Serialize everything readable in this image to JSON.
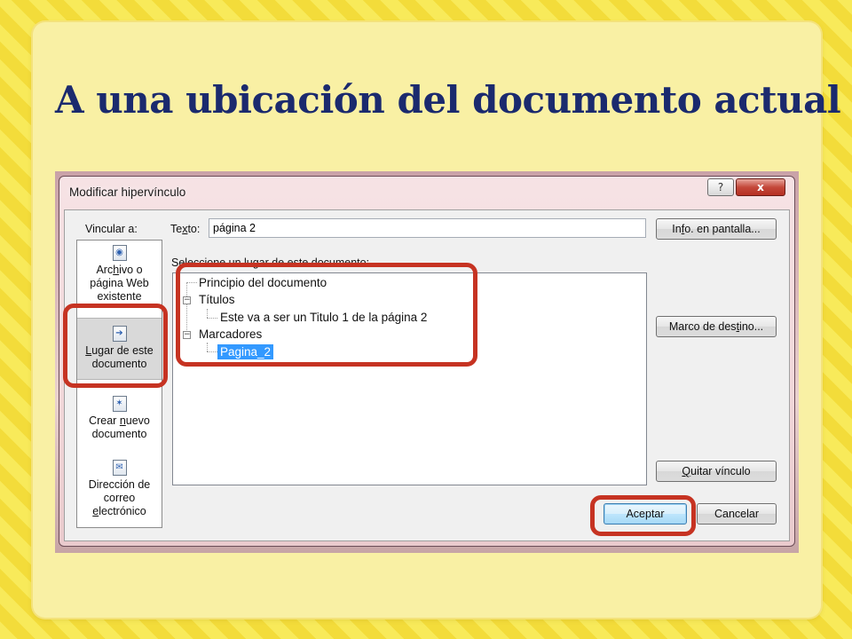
{
  "slide": {
    "title": "A una ubicación del documento actual"
  },
  "dialog": {
    "title": "Modificar hipervínculo",
    "help_label": "?",
    "close_label": "x",
    "link_to_label": "Vincular a:",
    "text_label_pre": "Te",
    "text_label_u": "x",
    "text_label_post": "to:",
    "text_value": "página 2",
    "select_place_label": "Seleccione un lugar de este documento:",
    "nav": {
      "existing_file": [
        "Arc",
        "h",
        "ivo o",
        "página Web",
        "existente"
      ],
      "this_document": [
        "L",
        "ugar de este",
        "documento"
      ],
      "new_document": [
        "Crear ",
        "n",
        "uevo",
        "documento"
      ],
      "email": [
        "Dirección de",
        "correo",
        "e",
        "lectrónico"
      ]
    },
    "tree": {
      "top": "Principio del documento",
      "headings": "Títulos",
      "heading_1": "Este va a ser un Titulo 1 de la página 2",
      "bookmarks": "Marcadores",
      "bookmark_1": "Pagina_2"
    },
    "buttons": {
      "screentip": [
        "In",
        "f",
        "o. en pantalla..."
      ],
      "target_frame": [
        "Marco de des",
        "t",
        "ino..."
      ],
      "remove_link": [
        "",
        "Q",
        "uitar vínculo"
      ],
      "ok": "Aceptar",
      "cancel": "Cancelar"
    }
  },
  "colors": {
    "title": "#1b2a6e",
    "highlight": "#c63322",
    "selection": "#3399ff",
    "slide_panel": "#f9f0a4"
  }
}
